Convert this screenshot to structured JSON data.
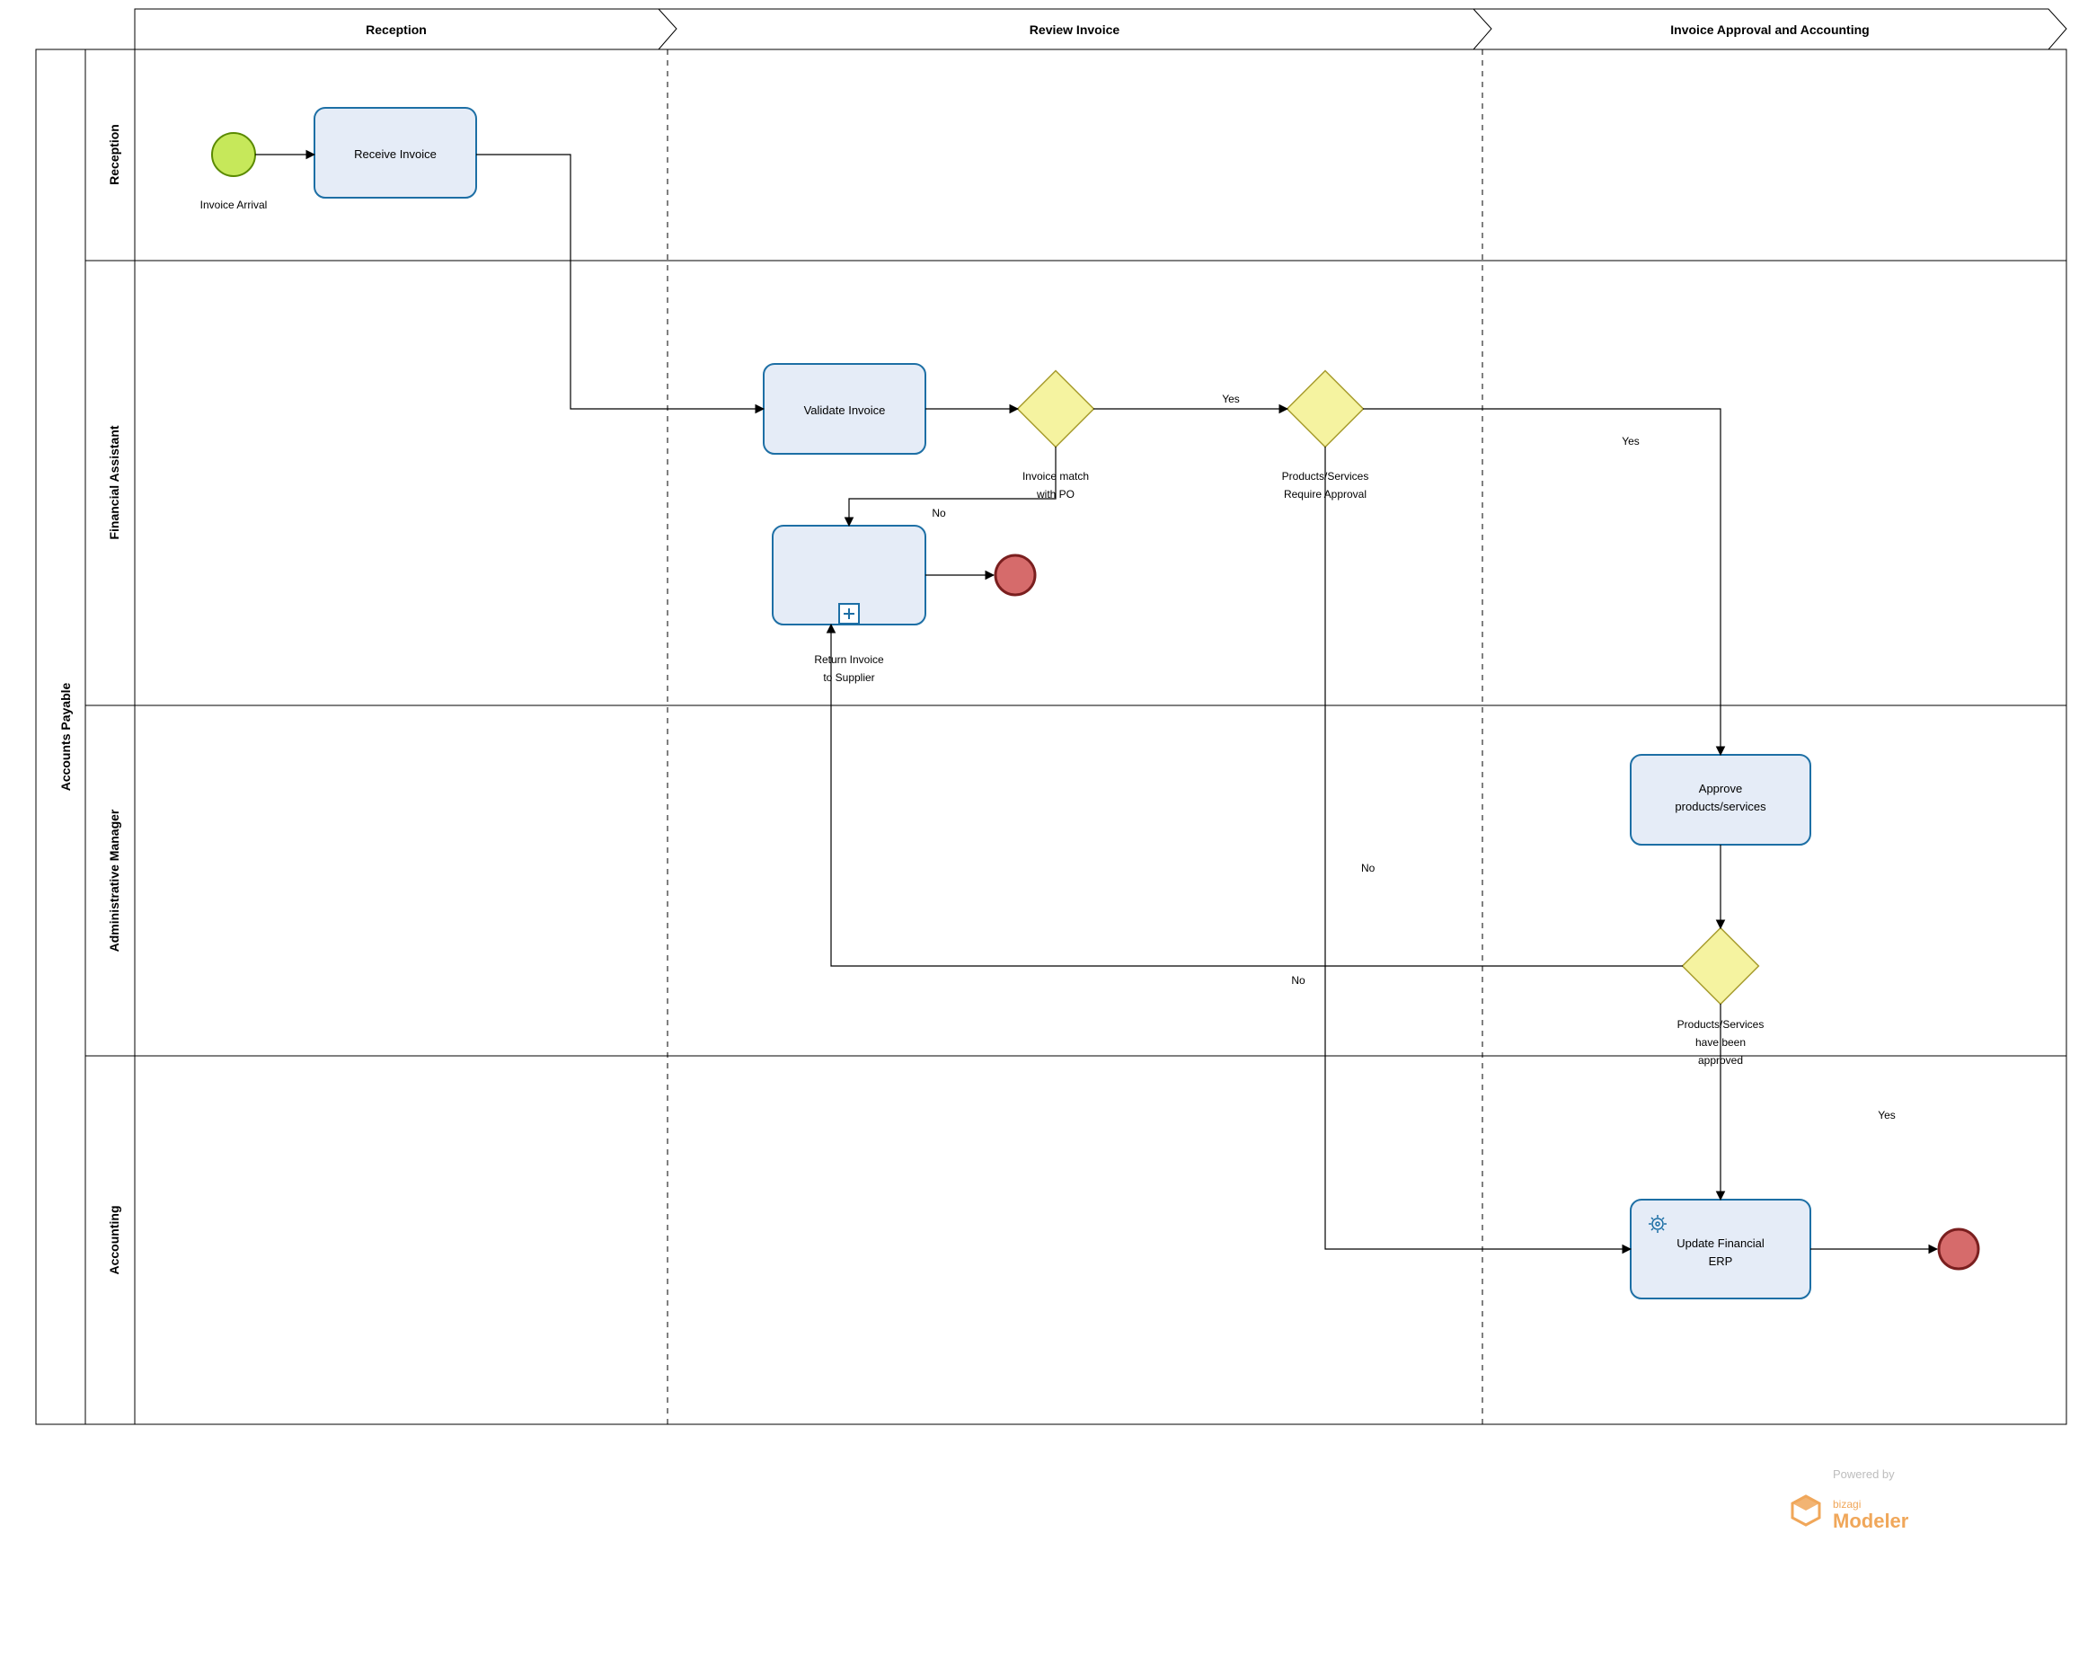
{
  "pool": {
    "name": "Accounts Payable"
  },
  "lanes": [
    {
      "key": "reception",
      "name": "Reception"
    },
    {
      "key": "financial_assistant",
      "name": "Financial Assistant"
    },
    {
      "key": "administrative_manager",
      "name": "Administrative Manager"
    },
    {
      "key": "accounting",
      "name": "Accounting"
    }
  ],
  "phases": [
    {
      "key": "p1",
      "name": "Reception"
    },
    {
      "key": "p2",
      "name": "Review Invoice"
    },
    {
      "key": "p3",
      "name": "Invoice Approval and Accounting"
    }
  ],
  "events": {
    "start": {
      "label": "Invoice Arrival"
    },
    "end1": {
      "label": ""
    },
    "end2": {
      "label": ""
    }
  },
  "tasks": {
    "receive_invoice": "Receive Invoice",
    "validate_invoice": "Validate Invoice",
    "return_invoice": "Return Invoice to Supplier",
    "approve_products": "Approve products/services",
    "update_erp": "Update Financial ERP"
  },
  "gateways": {
    "g1": {
      "label": "Invoice match with PO",
      "yes": "Yes",
      "no": "No"
    },
    "g2": {
      "label": "Products/Services Require Approval",
      "yes": "Yes",
      "no": "No"
    },
    "g3": {
      "label": "Products/Services have been approved",
      "yes": "Yes",
      "no": "No"
    }
  },
  "footer": {
    "powered_by": "Powered by",
    "brand_small": "bizagi",
    "brand": "Modeler"
  }
}
